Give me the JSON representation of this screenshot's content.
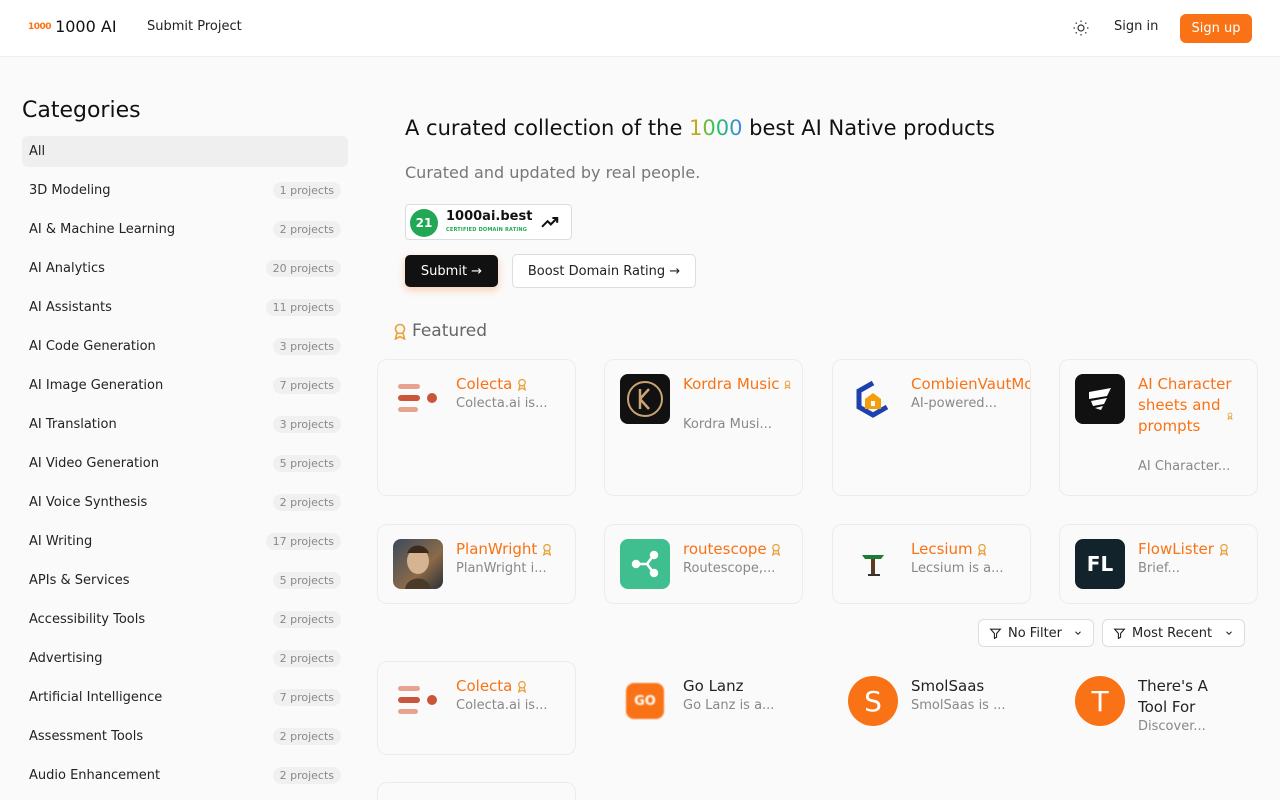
{
  "header": {
    "logo_mark": "1000",
    "logo_text": "1000 AI",
    "submit_project": "Submit Project",
    "sign_in": "Sign in",
    "sign_up": "Sign up"
  },
  "sidebar": {
    "title": "Categories",
    "items": [
      {
        "label": "All",
        "count": ""
      },
      {
        "label": "3D Modeling",
        "count": "1 projects"
      },
      {
        "label": "AI & Machine Learning",
        "count": "2 projects"
      },
      {
        "label": "AI Analytics",
        "count": "20 projects"
      },
      {
        "label": "AI Assistants",
        "count": "11 projects"
      },
      {
        "label": "AI Code Generation",
        "count": "3 projects"
      },
      {
        "label": "AI Image Generation",
        "count": "7 projects"
      },
      {
        "label": "AI Translation",
        "count": "3 projects"
      },
      {
        "label": "AI Video Generation",
        "count": "5 projects"
      },
      {
        "label": "AI Voice Synthesis",
        "count": "2 projects"
      },
      {
        "label": "AI Writing",
        "count": "17 projects"
      },
      {
        "label": "APIs & Services",
        "count": "5 projects"
      },
      {
        "label": "Accessibility Tools",
        "count": "2 projects"
      },
      {
        "label": "Advertising",
        "count": "2 projects"
      },
      {
        "label": "Artificial Intelligence",
        "count": "7 projects"
      },
      {
        "label": "Assessment Tools",
        "count": "2 projects"
      },
      {
        "label": "Audio Enhancement",
        "count": "2 projects"
      }
    ]
  },
  "hero": {
    "title_pre": "A curated collection of the ",
    "title_num": "1000",
    "title_post": " best AI Native products",
    "subtitle": "Curated and updated by real people.",
    "badge_score": "21",
    "badge_domain": "1000ai.best",
    "badge_cert": "CERTIFIED DOMAIN RATING",
    "submit_btn": "Submit →",
    "boost_btn": "Boost Domain Rating →"
  },
  "featured": {
    "title": "Featured",
    "cards": [
      {
        "name": "Colecta",
        "desc": "Colecta.ai is..."
      },
      {
        "name": "Kordra Music",
        "desc": "Kordra Musi..."
      },
      {
        "name": "CombienVautMonLo",
        "desc": "AI-powered..."
      },
      {
        "name": "AI Character sheets and prompts",
        "desc": "AI Character..."
      },
      {
        "name": "PlanWright",
        "desc": "PlanWright i..."
      },
      {
        "name": "routescope",
        "desc": "Routescope,..."
      },
      {
        "name": "Lecsium",
        "desc": "Lecsium is a..."
      },
      {
        "name": "FlowLister",
        "desc": "Brief..."
      }
    ]
  },
  "filters": {
    "no_filter": "No Filter",
    "sort": "Most Recent"
  },
  "recent": {
    "cards": [
      {
        "name": "Colecta",
        "desc": "Colecta.ai is..."
      },
      {
        "name": "Go Lanz",
        "desc": "Go Lanz is a...",
        "logo_text": "GO"
      },
      {
        "name": "SmolSaas",
        "desc": "SmolSaas is ...",
        "logo_text": "S"
      },
      {
        "name": "There's A Tool For",
        "desc": "Discover...",
        "logo_text": "T"
      }
    ]
  },
  "logos": {
    "flowlister": "FL"
  },
  "colors": {
    "accent": "#f97316",
    "badge_green": "#22a755"
  }
}
